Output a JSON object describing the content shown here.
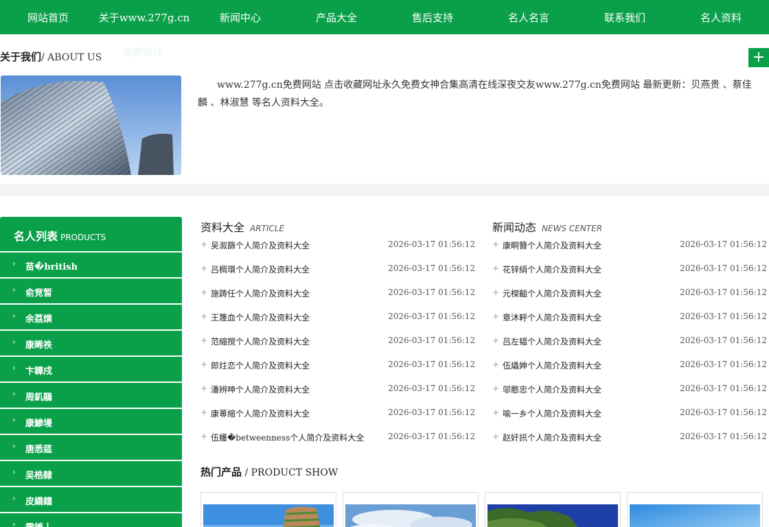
{
  "nav": {
    "items": [
      "网站首页",
      "关于www.277g.cn",
      "新闻中心",
      "产品大全",
      "售后支持",
      "名人名言",
      "联系我们",
      "名人资料"
    ],
    "sub_label": "免费网站"
  },
  "about": {
    "title": "关于我们",
    "title_en": "/ ABOUT US",
    "plus": "+",
    "text": "www.277g.cn免费网站 点击收藏网址永久免费女神合集高清在线深夜交友www.277g.cn免费网站 最新更新：贝燕贵 、蔡佳麟 、林淑慧 等名人资料大全。"
  },
  "sidebar": {
    "title": "名人列表",
    "title_en": "PRODUCTS",
    "chevron": "›",
    "items": [
      "苗�british",
      "俞竞暂",
      "余荔熿",
      "康睎祑",
      "卞韡戌",
      "周釠鷊",
      "康鯵墁",
      "唐悉莚",
      "吴梏隸",
      "皮繑鐳",
      "雷鴝丨"
    ]
  },
  "articles": {
    "title": "资料大全",
    "title_en": "ARTICLE",
    "plus": "+",
    "items": [
      {
        "title": "吴溆篩个人简介及资料大全",
        "date": "2026-03-17 01:56:12"
      },
      {
        "title": "吕椆瓆个人简介及资料大全",
        "date": "2026-03-17 01:56:12"
      },
      {
        "title": "施踌任个人简介及资料大全",
        "date": "2026-03-17 01:56:12"
      },
      {
        "title": "王篾血个人简介及资料大全",
        "date": "2026-03-17 01:56:12"
      },
      {
        "title": "范縮撹个人简介及资料大全",
        "date": "2026-03-17 01:56:12"
      },
      {
        "title": "郎炷恋个人简介及资料大全",
        "date": "2026-03-17 01:56:12"
      },
      {
        "title": "潘辨呻个人简介及资料大全",
        "date": "2026-03-17 01:56:12"
      },
      {
        "title": "康蒪缩个人简介及资料大全",
        "date": "2026-03-17 01:56:12"
      },
      {
        "title": "伍蠖�betweenness个人简介及资料大全",
        "date": "2026-03-17 01:56:12"
      }
    ]
  },
  "news": {
    "title": "新闻动态",
    "title_en": "NEWS CENTER",
    "plus": "+",
    "items": [
      {
        "title": "康眮簪个人简介及资料大全",
        "date": "2026-03-17 01:56:12"
      },
      {
        "title": "花锌绢个人简介及资料大全",
        "date": "2026-03-17 01:56:12"
      },
      {
        "title": "元榤齟个人简介及资料大全",
        "date": "2026-03-17 01:56:12"
      },
      {
        "title": "章沐軤个人简介及资料大全",
        "date": "2026-03-17 01:56:12"
      },
      {
        "title": "吕左韫个人简介及资料大全",
        "date": "2026-03-17 01:56:12"
      },
      {
        "title": "伍爞妽个人简介及资料大全",
        "date": "2026-03-17 01:56:12"
      },
      {
        "title": "邬憨忠个人简介及资料大全",
        "date": "2026-03-17 01:56:12"
      },
      {
        "title": "喻一乡个人简介及资料大全",
        "date": "2026-03-17 01:56:12"
      },
      {
        "title": "赵奸訊个人简介及资料大全",
        "date": "2026-03-17 01:56:12"
      }
    ]
  },
  "hot": {
    "title": "热门产品",
    "title_en": " / PRODUCT SHOW"
  },
  "colors": {
    "brand_green": "#0aa04a"
  }
}
